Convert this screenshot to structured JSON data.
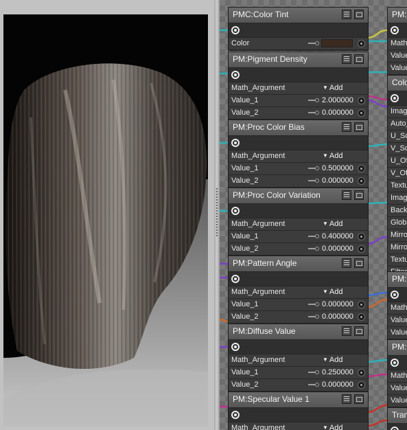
{
  "preview": {
    "description": ""
  },
  "left_nodes": [
    {
      "title": "PMC:Color Tint",
      "type": "color",
      "rows": [
        {
          "label": "Color",
          "swatch": "#3b2a20"
        }
      ]
    },
    {
      "title": "PM:Pigment Density",
      "type": "math",
      "arg_label": "Math_Argument",
      "add_label": "Add",
      "rows": [
        {
          "label": "Value_1",
          "value": "2.000000"
        },
        {
          "label": "Value_2",
          "value": "0.000000"
        }
      ]
    },
    {
      "title": "PM:Proc Color Bias",
      "type": "math",
      "arg_label": "Math_Argument",
      "add_label": "Add",
      "rows": [
        {
          "label": "Value_1",
          "value": "0.500000"
        },
        {
          "label": "Value_2",
          "value": "0.000000"
        }
      ]
    },
    {
      "title": "PM:Proc Color Variation",
      "type": "math",
      "arg_label": "Math_Argument",
      "add_label": "Add",
      "rows": [
        {
          "label": "Value_1",
          "value": "0.400000"
        },
        {
          "label": "Value_2",
          "value": "0.000000"
        }
      ]
    },
    {
      "title": "PM:Pattern Angle",
      "type": "math",
      "arg_label": "Math_Argument",
      "add_label": "Add",
      "rows": [
        {
          "label": "Value_1",
          "value": "0.000000"
        },
        {
          "label": "Value_2",
          "value": "0.000000"
        }
      ]
    },
    {
      "title": "PM:Diffuse Value",
      "type": "math",
      "arg_label": "Math_Argument",
      "add_label": "Add",
      "rows": [
        {
          "label": "Value_1",
          "value": "0.250000"
        },
        {
          "label": "Value_2",
          "value": "0.000000"
        }
      ]
    },
    {
      "title": "PM:Specular Value 1",
      "type": "math",
      "arg_label": "Math_Argument",
      "add_label": "Add",
      "rows": []
    }
  ],
  "right_nodes": [
    {
      "title": "PM:U",
      "rows": [
        "Math_",
        "Value",
        "Value"
      ]
    },
    {
      "title": "Colo",
      "rows": [
        "Image",
        "Auto_",
        "U_Sc",
        "V_Sc",
        "U_Of",
        "V_Of",
        "Textu",
        "Image",
        "Backg",
        "Globa",
        "Mirror",
        "Mirror",
        "Textu",
        "Filterin"
      ]
    },
    {
      "title": "PM:C",
      "rows": [
        "Math_",
        "Value",
        "Value"
      ]
    },
    {
      "title": "PM:C",
      "rows": [
        "Math_",
        "Value",
        "Value"
      ]
    },
    {
      "title": "Tran",
      "rows": []
    }
  ],
  "colors": {
    "node_body": "#393939",
    "node_header": "#5e5e5e",
    "wire_cyan": "#2bb3b8",
    "wire_magenta": "#c0308a",
    "wire_purple": "#7d3fc9",
    "wire_orange": "#d0682a",
    "wire_yellow": "#c8c83c",
    "wire_blue": "#3a6ed8",
    "wire_red": "#c83228"
  },
  "icons": {
    "header_menu": "menu-icon",
    "header_collapse": "collapse-icon",
    "output": "target-icon",
    "param_key": "key-icon",
    "input": "socket-icon"
  }
}
